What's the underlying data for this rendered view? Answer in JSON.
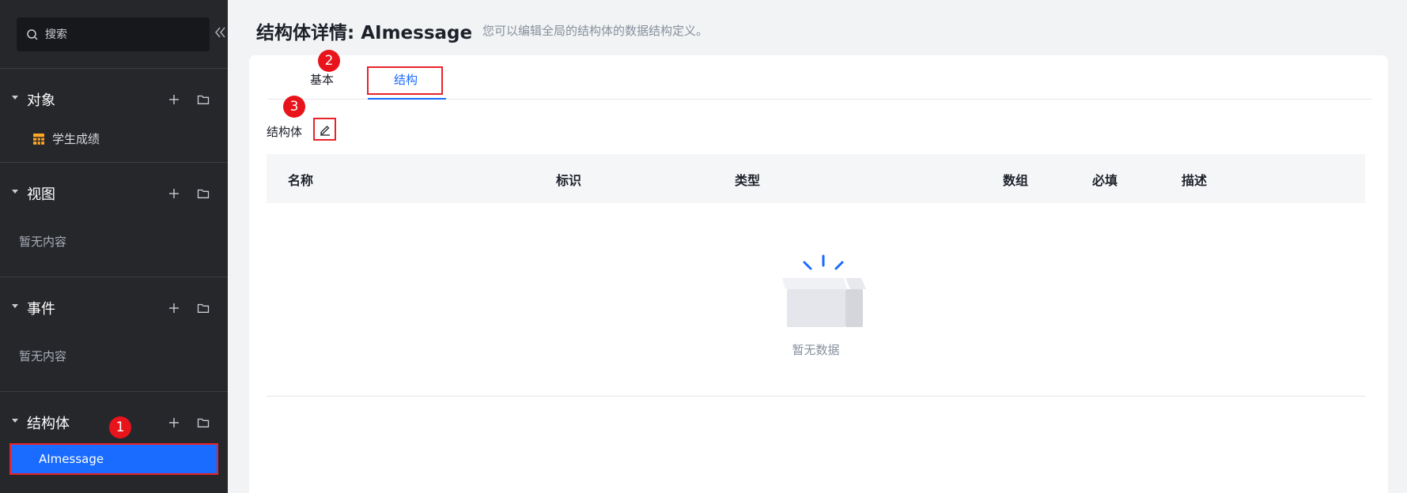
{
  "sidebar": {
    "search_placeholder": "搜索",
    "sections": [
      {
        "title": "对象",
        "items": [
          {
            "label": "学生成绩"
          }
        ]
      },
      {
        "title": "视图",
        "empty": "暂无内容"
      },
      {
        "title": "事件",
        "empty": "暂无内容"
      },
      {
        "title": "结构体",
        "items": [
          {
            "label": "AImessage",
            "selected": true
          }
        ]
      }
    ]
  },
  "header": {
    "title": "结构体详情: AImessage",
    "description": "您可以编辑全局的结构体的数据结构定义。"
  },
  "tabs": [
    {
      "label": "基本",
      "active": false
    },
    {
      "label": "结构",
      "active": true
    }
  ],
  "structure": {
    "label": "结构体",
    "columns": [
      "名称",
      "标识",
      "类型",
      "数组",
      "必填",
      "描述"
    ],
    "empty_text": "暂无数据"
  },
  "annotations": [
    "1",
    "2",
    "3"
  ],
  "colors": {
    "accent": "#1a6bff",
    "sidebar_bg": "#26272b",
    "highlight_border": "#e8232b",
    "badge": "#e8141c"
  }
}
